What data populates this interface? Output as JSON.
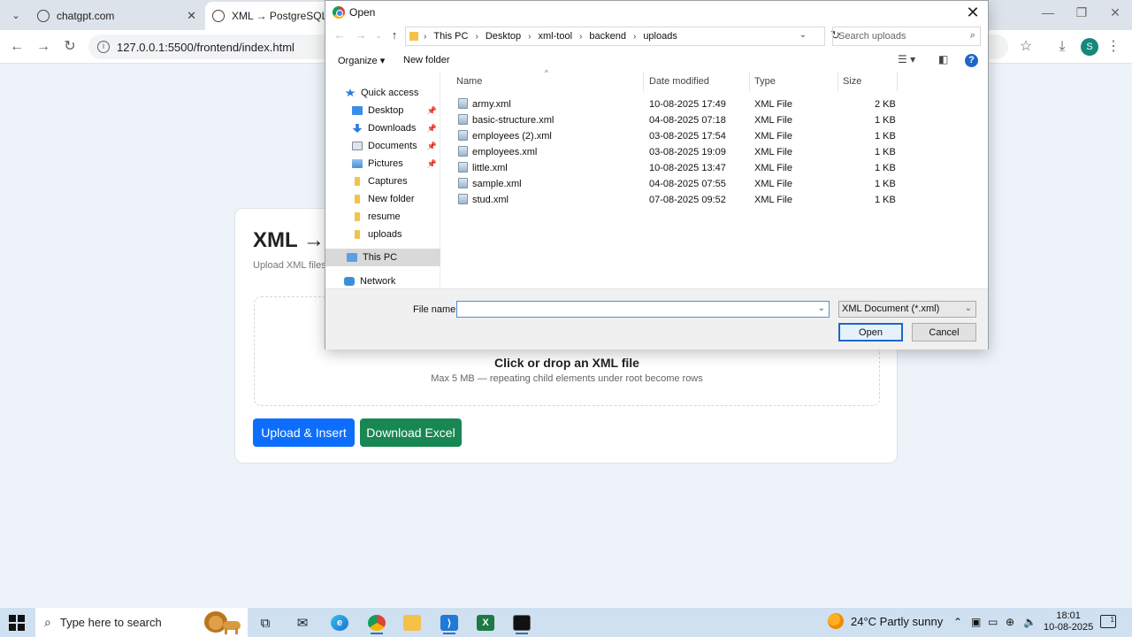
{
  "browser": {
    "tabs": [
      {
        "title": "chatgpt.com",
        "active": false
      },
      {
        "title": "XML → PostgreSQL → Excel",
        "active": true
      }
    ],
    "url": "127.0.0.1:5500/frontend/index.html",
    "profile_initial": "S"
  },
  "page": {
    "title": "XML →",
    "subtitle": "Upload XML files",
    "dropzone_title": "Click or drop an XML file",
    "dropzone_hint": "Max 5 MB — repeating child elements under root become rows",
    "upload_button": "Upload & Insert",
    "download_button": "Download Excel",
    "colors": {
      "upload": "#0d6efd",
      "download": "#198754"
    }
  },
  "dialog": {
    "title": "Open",
    "breadcrumb": [
      "This PC",
      "Desktop",
      "xml-tool",
      "backend",
      "uploads"
    ],
    "search_placeholder": "Search uploads",
    "organize_label": "Organize",
    "new_folder_label": "New folder",
    "nav": {
      "quick_access": "Quick access",
      "items": [
        "Desktop",
        "Downloads",
        "Documents",
        "Pictures",
        "Captures",
        "New folder",
        "resume",
        "uploads"
      ],
      "this_pc": "This PC",
      "network": "Network"
    },
    "columns": {
      "name": "Name",
      "date": "Date modified",
      "type": "Type",
      "size": "Size"
    },
    "files": [
      {
        "name": "army.xml",
        "date": "10-08-2025 17:49",
        "type": "XML File",
        "size": "2 KB"
      },
      {
        "name": "basic-structure.xml",
        "date": "04-08-2025 07:18",
        "type": "XML File",
        "size": "1 KB"
      },
      {
        "name": "employees (2).xml",
        "date": "03-08-2025 17:54",
        "type": "XML File",
        "size": "1 KB"
      },
      {
        "name": "employees.xml",
        "date": "03-08-2025 19:09",
        "type": "XML File",
        "size": "1 KB"
      },
      {
        "name": "little.xml",
        "date": "10-08-2025 13:47",
        "type": "XML File",
        "size": "1 KB"
      },
      {
        "name": "sample.xml",
        "date": "04-08-2025 07:55",
        "type": "XML File",
        "size": "1 KB"
      },
      {
        "name": "stud.xml",
        "date": "07-08-2025 09:52",
        "type": "XML File",
        "size": "1 KB"
      }
    ],
    "file_name_label": "File name:",
    "file_name_value": "",
    "file_type": "XML Document (*.xml)",
    "open_button": "Open",
    "cancel_button": "Cancel"
  },
  "taskbar": {
    "search_placeholder": "Type here to search",
    "weather": "24°C  Partly sunny",
    "time": "18:01",
    "date": "10-08-2025",
    "notification_count": "1"
  }
}
